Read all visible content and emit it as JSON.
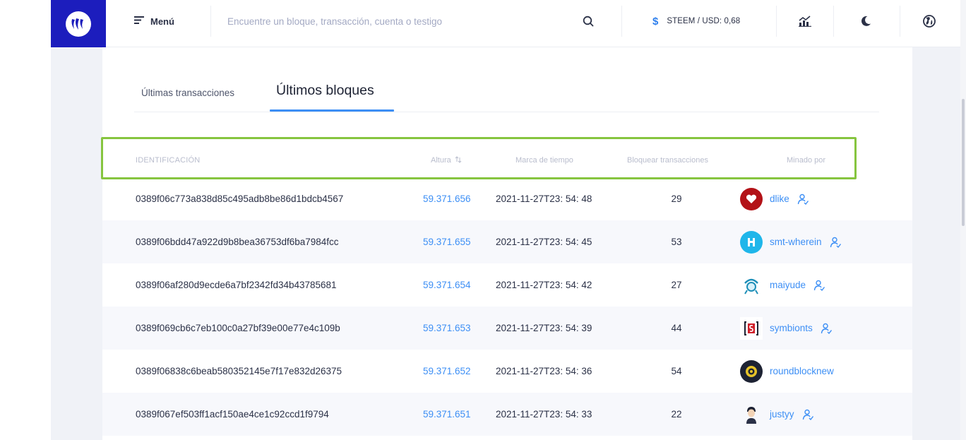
{
  "header": {
    "menu_label": "Menú",
    "search_placeholder": "Encuentre un bloque, transacción, cuenta o testigo",
    "price_symbol": "$",
    "price_text": "STEEM / USD: 0,68",
    "icons": [
      "steem-logo-icon",
      "menu-icon",
      "search-icon",
      "dollar-icon",
      "chart-icon",
      "moon-icon",
      "globe-icon"
    ]
  },
  "tabs": {
    "transactions": "Últimas transacciones",
    "blocks": "Últimos bloques",
    "active": "blocks"
  },
  "table": {
    "columns": {
      "id": "IDENTIFICACIÓN",
      "height": "Altura",
      "height_sort_icon": "sort-icon",
      "timestamp": "Marca de tiempo",
      "tx_count": "Bloquear transacciones",
      "miner": "Minado por"
    },
    "rows": [
      {
        "id": "0389f06c773a838d85c495adb8be86d1bdcb4567",
        "height": "59.371.656",
        "timestamp": "2021-11-27T23: 54: 48",
        "tx_count": "29",
        "miner": "dlike",
        "witness": true,
        "avatar": "dlike-avatar-icon"
      },
      {
        "id": "0389f06bdd47a922d9b8bea36753df6ba7984fcc",
        "height": "59.371.655",
        "timestamp": "2021-11-27T23: 54: 45",
        "tx_count": "53",
        "miner": "smt-wherein",
        "witness": true,
        "avatar": "smt-wherein-avatar-icon"
      },
      {
        "id": "0389f06af280d9ecde6a7bf2342fd34b43785681",
        "height": "59.371.654",
        "timestamp": "2021-11-27T23: 54: 42",
        "tx_count": "27",
        "miner": "maiyude",
        "witness": true,
        "avatar": "maiyude-avatar-icon"
      },
      {
        "id": "0389f069cb6c7eb100c0a27bf39e00e77e4c109b",
        "height": "59.371.653",
        "timestamp": "2021-11-27T23: 54: 39",
        "tx_count": "44",
        "miner": "symbionts",
        "witness": true,
        "avatar": "symbionts-avatar-icon"
      },
      {
        "id": "0389f06838c6beab580352145e7f17e832d26375",
        "height": "59.371.652",
        "timestamp": "2021-11-27T23: 54: 36",
        "tx_count": "54",
        "miner": "roundblocknew",
        "witness": false,
        "avatar": "roundblocknew-avatar-icon"
      },
      {
        "id": "0389f067ef503ff1acf150ae4ce1c92ccd1f9794",
        "height": "59.371.651",
        "timestamp": "2021-11-27T23: 54: 33",
        "tx_count": "22",
        "miner": "justyy",
        "witness": true,
        "avatar": "justyy-avatar-icon"
      }
    ]
  },
  "colors": {
    "brand": "#1c1dbd",
    "accent": "#3d8ff5",
    "highlight_box": "#86c53f",
    "text": "#2b3147",
    "muted": "#b9bdcd"
  }
}
